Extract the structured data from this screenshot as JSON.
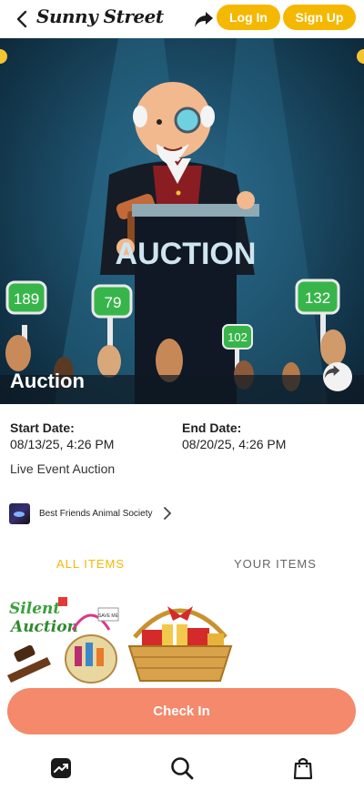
{
  "header": {
    "logo_text": "Sunny Street",
    "login_label": "Log In",
    "signup_label": "Sign Up",
    "accent_color": "#f5b800"
  },
  "hero": {
    "title": "Auction",
    "podium_text": "AUCTION",
    "paddles": [
      "189",
      "79",
      "102",
      "132"
    ]
  },
  "event": {
    "start_label": "Start Date:",
    "start_value": "08/13/25, 4:26 PM",
    "end_label": "End Date:",
    "end_value": "08/20/25, 4:26 PM",
    "type": "Live Event Auction"
  },
  "organization": {
    "name": "Best Friends Animal Society"
  },
  "tabs": {
    "all_items": "ALL ITEMS",
    "your_items": "YOUR ITEMS",
    "active": "all_items"
  },
  "items": [
    {
      "image_text_line1": "Silent",
      "image_text_line2": "Auction",
      "badge_text": "SAVE ME"
    },
    {
      "image_kind": "gift-basket"
    }
  ],
  "checkin": {
    "label": "Check In",
    "color": "#f4896b"
  },
  "bottom_nav": {
    "icons": [
      "trending-icon",
      "search-icon",
      "shopping-bag-icon"
    ]
  }
}
